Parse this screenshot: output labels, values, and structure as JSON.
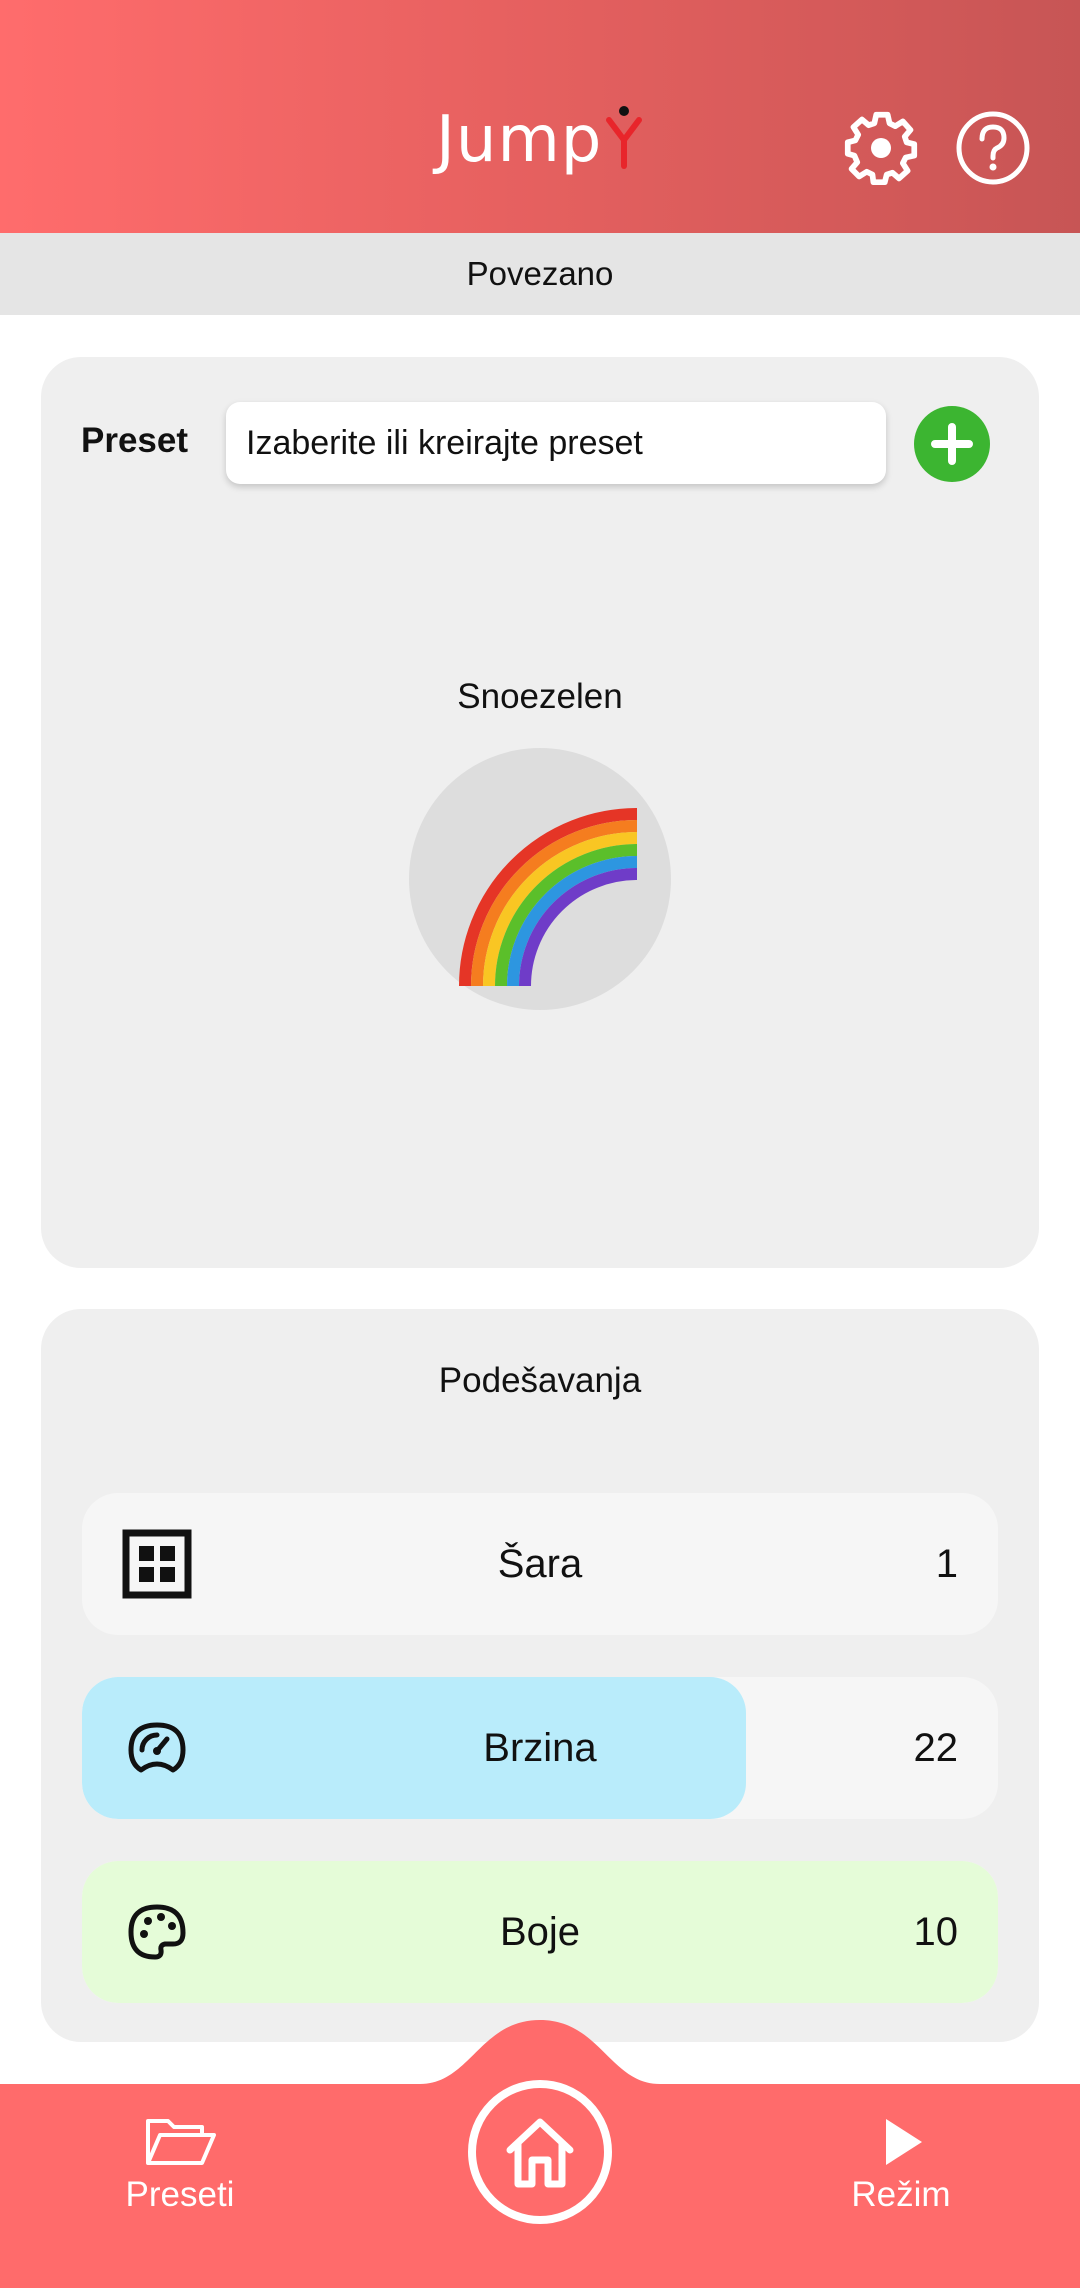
{
  "header": {
    "logo_text": "Jump",
    "settings_icon": "gear-icon",
    "help_icon": "question-mark-icon"
  },
  "status": {
    "text": "Povezano"
  },
  "preset": {
    "label": "Preset",
    "input_value": "Izaberite ili kreirajte preset",
    "add_icon": "plus-icon",
    "mode_name": "Snoezelen",
    "mode_icon": "rainbow-icon"
  },
  "settings": {
    "title": "Podešavanja",
    "rows": [
      {
        "icon": "grid-icon",
        "label": "Šara",
        "value": "1",
        "fill_fraction": 0,
        "fill_color": "#f6f6f6"
      },
      {
        "icon": "speedometer-icon",
        "label": "Brzina",
        "value": "22",
        "fill_fraction": 0.725,
        "fill_color": "#b9ecfb"
      },
      {
        "icon": "palette-icon",
        "label": "Boje",
        "value": "10",
        "fill_fraction": 1.0,
        "fill_color": "#e5fcd8"
      }
    ]
  },
  "nav": {
    "presets_label": "Preseti",
    "presets_icon": "folder-open-icon",
    "home_icon": "home-icon",
    "mode_label": "Režim",
    "mode_icon": "play-icon"
  },
  "colors": {
    "header_start": "#ff6c6c",
    "header_end": "#c75555",
    "nav_bg": "#ff6b6b",
    "add_button": "#3cb531",
    "logo_figure": "#e8252b"
  }
}
